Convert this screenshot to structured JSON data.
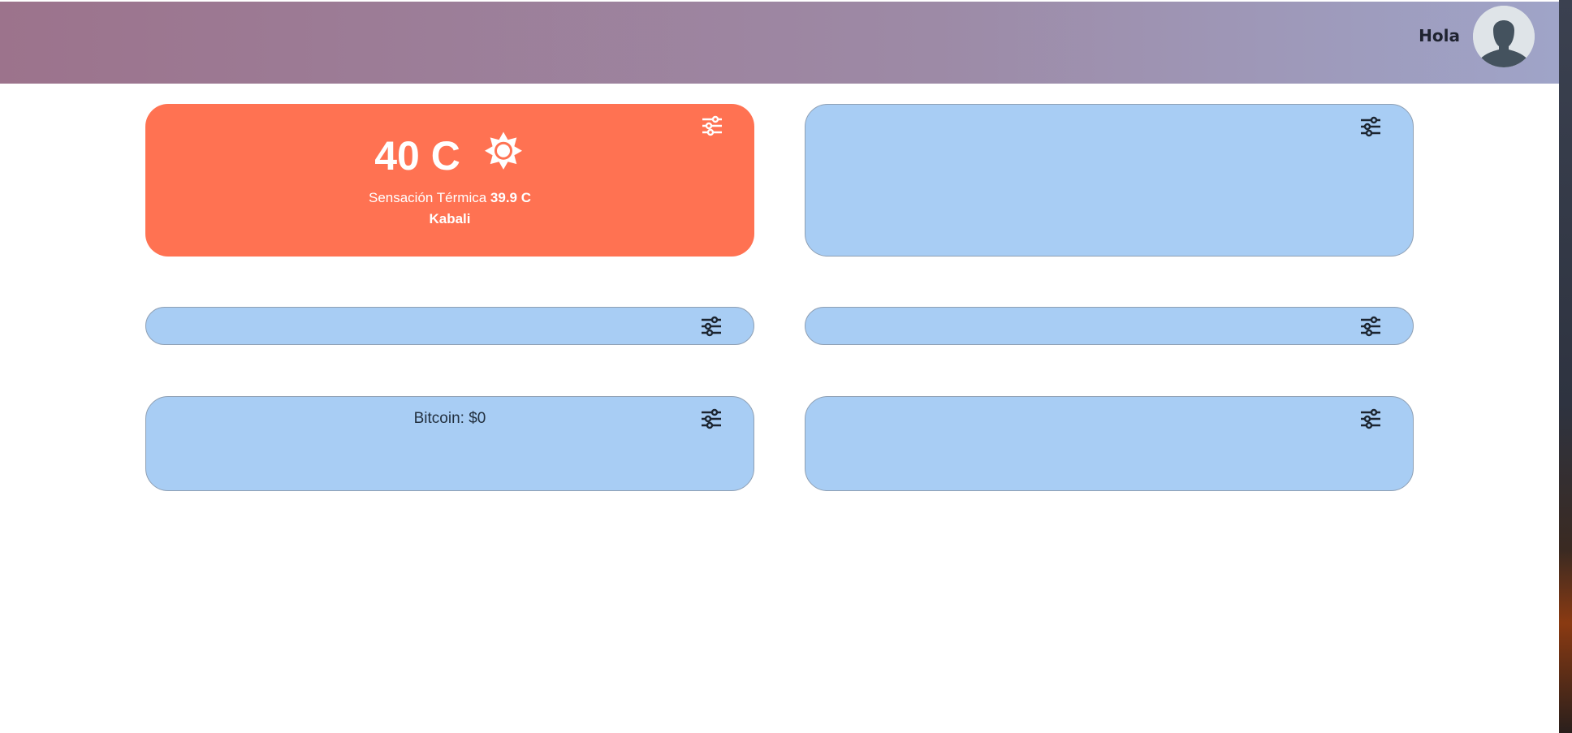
{
  "header": {
    "greeting": "Hola"
  },
  "colors": {
    "weather_card": "#ff7252",
    "widget_card": "#a8cdf4",
    "header_gradient_start": "#9c738c",
    "header_gradient_end": "#9fa4c8"
  },
  "icons": {
    "settings": "sliders-icon",
    "weather": "sun-icon",
    "avatar": "user-avatar-icon"
  },
  "weather": {
    "temperature": "40 C",
    "feels_like_label": "Sensación Térmica",
    "feels_like_value": "39.9 C",
    "city": "Kabali"
  },
  "bitcoin": {
    "text": "Bitcoin: $0"
  }
}
